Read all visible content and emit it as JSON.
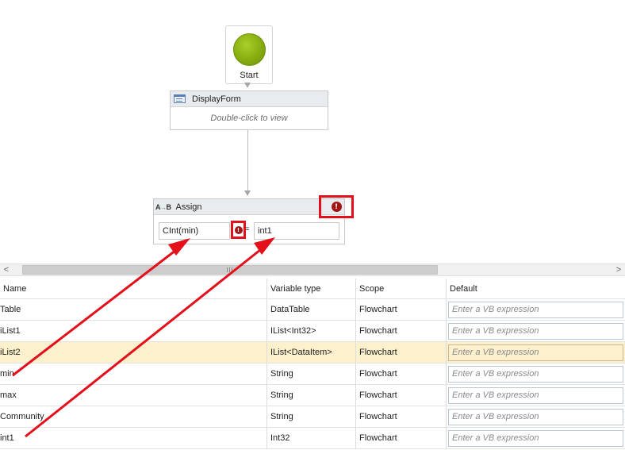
{
  "workflow": {
    "start": {
      "label": "Start"
    },
    "display_form": {
      "title": "DisplayForm",
      "hint": "Double-click to view"
    },
    "assign": {
      "icon_text": "A+B",
      "title": "Assign",
      "to_value": "CInt(min)",
      "equals": "=",
      "value": "int1",
      "error_icon": "!"
    }
  },
  "scrollbar": {
    "left_arrow": "<",
    "right_arrow": ">"
  },
  "variables": {
    "headers": {
      "name": "Name",
      "type": "Variable type",
      "scope": "Scope",
      "default": "Default"
    },
    "rows": [
      {
        "name": "Table",
        "type": "DataTable",
        "scope": "Flowchart",
        "default_placeholder": "Enter a VB expression"
      },
      {
        "name": "iList1",
        "type": "IList<Int32>",
        "scope": "Flowchart",
        "default_placeholder": "Enter a VB expression"
      },
      {
        "name": "iList2",
        "type": "IList<DataItem>",
        "scope": "Flowchart",
        "default_placeholder": "Enter a VB expression"
      },
      {
        "name": "min",
        "type": "String",
        "scope": "Flowchart",
        "default_placeholder": "Enter a VB expression"
      },
      {
        "name": "max",
        "type": "String",
        "scope": "Flowchart",
        "default_placeholder": "Enter a VB expression"
      },
      {
        "name": "Community",
        "type": "String",
        "scope": "Flowchart",
        "default_placeholder": "Enter a VB expression"
      },
      {
        "name": "int1",
        "type": "Int32",
        "scope": "Flowchart",
        "default_placeholder": "Enter a VB expression"
      }
    ]
  },
  "colors": {
    "annotation_red": "#e3101c",
    "error_red": "#a31515",
    "start_green": "#86ad10",
    "selected_row": "#fdf0cc"
  },
  "icons": {
    "start": "start-circle-icon",
    "display_form": "form-icon",
    "assign": "assign-ab-icon",
    "error": "error-icon"
  }
}
